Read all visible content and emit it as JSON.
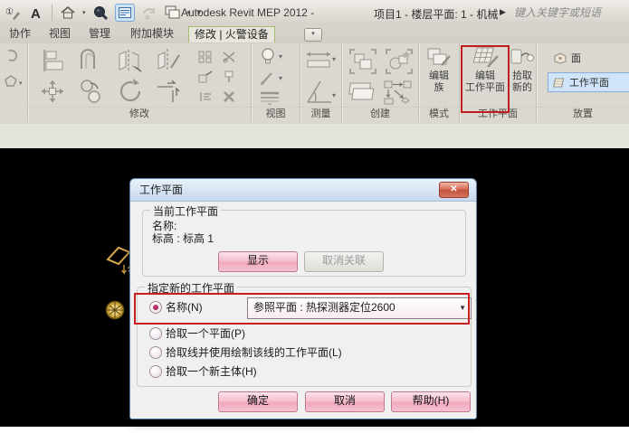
{
  "window": {
    "title_app": "Autodesk Revit MEP 2012 -",
    "title_doc": "项目1 - 楼层平面: 1 - 机械",
    "search_placeholder": "键入关键字或短语"
  },
  "glyphs": {
    "caret_down": "▾",
    "menu_down": "▼",
    "flyout_right": "▶",
    "close": "✕",
    "annotate_badge": "①",
    "text_tool": "A",
    "ribbon_minimize": "▾"
  },
  "tabs": {
    "items": [
      "协作",
      "视图",
      "管理",
      "附加模块"
    ],
    "active": "修改 | 火警设备"
  },
  "ribbon": {
    "panel_labels": {
      "modify": "修改",
      "view": "视图",
      "measure": "测量",
      "create": "创建",
      "mode": "模式",
      "workplane": "工作平面",
      "placement": "放置"
    },
    "mode_panel": {
      "edit_family": [
        "编辑",
        "族"
      ]
    },
    "workplane_panel": {
      "edit_workplane": [
        "编辑",
        "工作平面"
      ],
      "pick_new": [
        "拾取",
        "新的"
      ]
    },
    "placement_panel": {
      "face": "面",
      "workplane": "工作平面"
    }
  },
  "dialog": {
    "title": "工作平面",
    "current_group": {
      "label": "当前工作平面",
      "name_line": "名称:",
      "level_line": "标高 : 标高 1",
      "show_button": "显示",
      "dissociate_button": "取消关联"
    },
    "specify_group": {
      "label": "指定新的工作平面",
      "radio_name": "名称(N)",
      "combo_value": "参照平面 : 热探测器定位2600",
      "radio_pick_plane": "拾取一个平面(P)",
      "radio_pick_line": "拾取线并使用绘制该线的工作平面(L)",
      "radio_pick_host": "拾取一个新主体(H)"
    },
    "buttons": {
      "ok": "确定",
      "cancel": "取消",
      "help": "帮助(H)"
    }
  },
  "colors": {
    "annotation_red": "#c81e1e",
    "selection_blue": "#cfe4f8",
    "button_pink": "#f3afc4",
    "canvas_black": "#000000",
    "detector_gold": "#e8b43a"
  }
}
